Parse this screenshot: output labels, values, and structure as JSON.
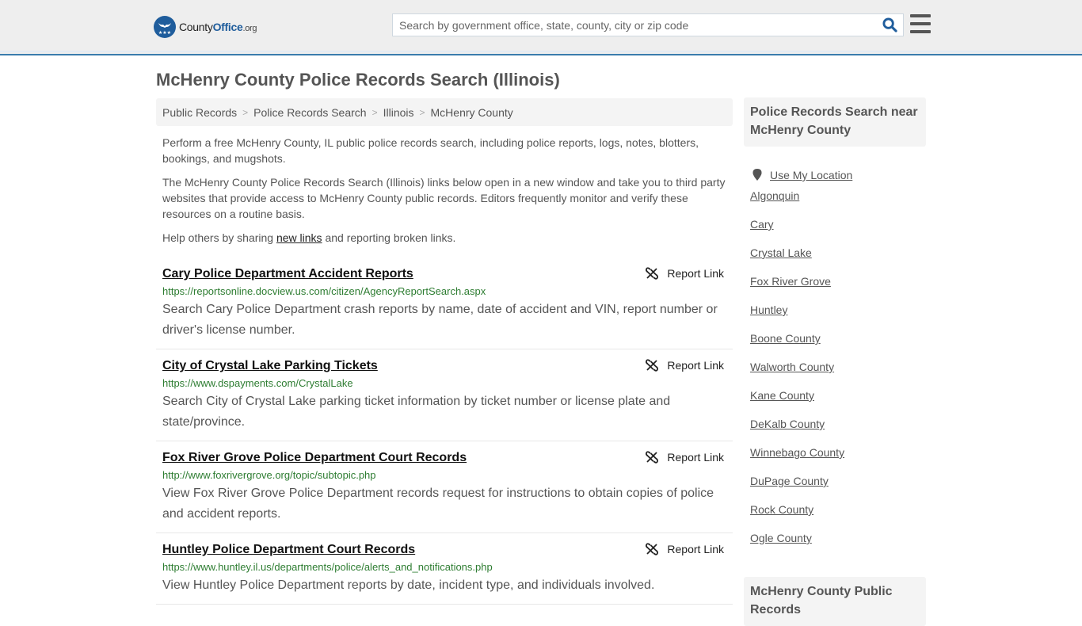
{
  "header": {
    "logo": {
      "name_part1": "County",
      "name_part2": "Office",
      "tld": ".org"
    },
    "search": {
      "placeholder": "Search by government office, state, county, city or zip code",
      "value": ""
    },
    "colors": {
      "brand": "#1f5d9c",
      "header_border": "#3a7cad"
    }
  },
  "page": {
    "title": "McHenry County Police Records Search (Illinois)",
    "breadcrumb": [
      "Public Records",
      "Police Records Search",
      "Illinois",
      "McHenry County"
    ],
    "intro": {
      "p1": "Perform a free McHenry County, IL public police records search, including police reports, logs, notes, blotters, bookings, and mugshots.",
      "p2": "The McHenry County Police Records Search (Illinois) links below open in a new window and take you to third party websites that provide access to McHenry County public records. Editors frequently monitor and verify these resources on a routine basis.",
      "p3_before": "Help others by sharing ",
      "p3_link": "new links",
      "p3_after": " and reporting broken links."
    },
    "report_link_label": "Report Link",
    "results": [
      {
        "title": "Cary Police Department Accident Reports",
        "url": "https://reportsonline.docview.us.com/citizen/AgencyReportSearch.aspx",
        "description": "Search Cary Police Department crash reports by name, date of accident and VIN, report number or driver's license number."
      },
      {
        "title": "City of Crystal Lake Parking Tickets",
        "url": "https://www.dspayments.com/CrystalLake",
        "description": "Search City of Crystal Lake parking ticket information by ticket number or license plate and state/province."
      },
      {
        "title": "Fox River Grove Police Department Court Records",
        "url": "http://www.foxrivergrove.org/topic/subtopic.php",
        "description": "View Fox River Grove Police Department records request for instructions to obtain copies of police and accident reports."
      },
      {
        "title": "Huntley Police Department Court Records",
        "url": "https://www.huntley.il.us/departments/police/alerts_and_notifications.php",
        "description": "View Huntley Police Department reports by date, incident type, and individuals involved."
      }
    ]
  },
  "sidebar": {
    "heading": "Police Records Search near McHenry County",
    "use_location": "Use My Location",
    "links": [
      "Algonquin",
      "Cary",
      "Crystal Lake",
      "Fox River Grove",
      "Huntley",
      "Boone County",
      "Walworth County",
      "Kane County",
      "DeKalb County",
      "Winnebago County",
      "DuPage County",
      "Rock County",
      "Ogle County"
    ],
    "heading2": "McHenry County Public Records"
  }
}
